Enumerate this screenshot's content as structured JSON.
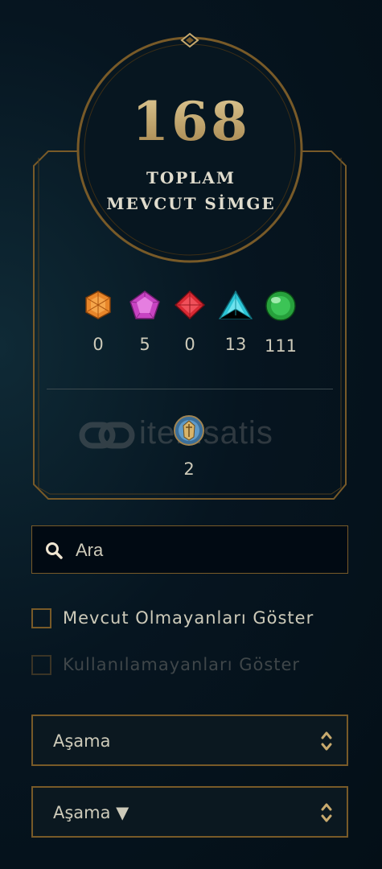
{
  "summary": {
    "total": "168",
    "label_line1": "TOPLAM",
    "label_line2": "MEVCUT SİMGE"
  },
  "gems": [
    {
      "icon": "orange-gem-icon",
      "color": "#e8862a",
      "count": "0"
    },
    {
      "icon": "purple-gem-icon",
      "color": "#c743c2",
      "count": "5"
    },
    {
      "icon": "red-gem-icon",
      "color": "#d92a34",
      "count": "0"
    },
    {
      "icon": "teal-gem-icon",
      "color": "#2cc5d6",
      "count": "13"
    },
    {
      "icon": "green-gem-icon",
      "color": "#27a13c",
      "count": "111"
    }
  ],
  "token": {
    "icon": "emblem-token-icon",
    "count": "2"
  },
  "watermark": {
    "text": "itemsatis"
  },
  "search": {
    "placeholder": "Ara"
  },
  "filters": {
    "show_unowned": "Mevcut Olmayanları Göster",
    "show_unusable": "Kullanılamayanları Göster"
  },
  "sort": {
    "primary": "Aşama",
    "secondary": "Aşama ▼"
  },
  "colors": {
    "gold": "#c8aa6e",
    "gold_dark": "#785a28",
    "background": "#061520"
  }
}
